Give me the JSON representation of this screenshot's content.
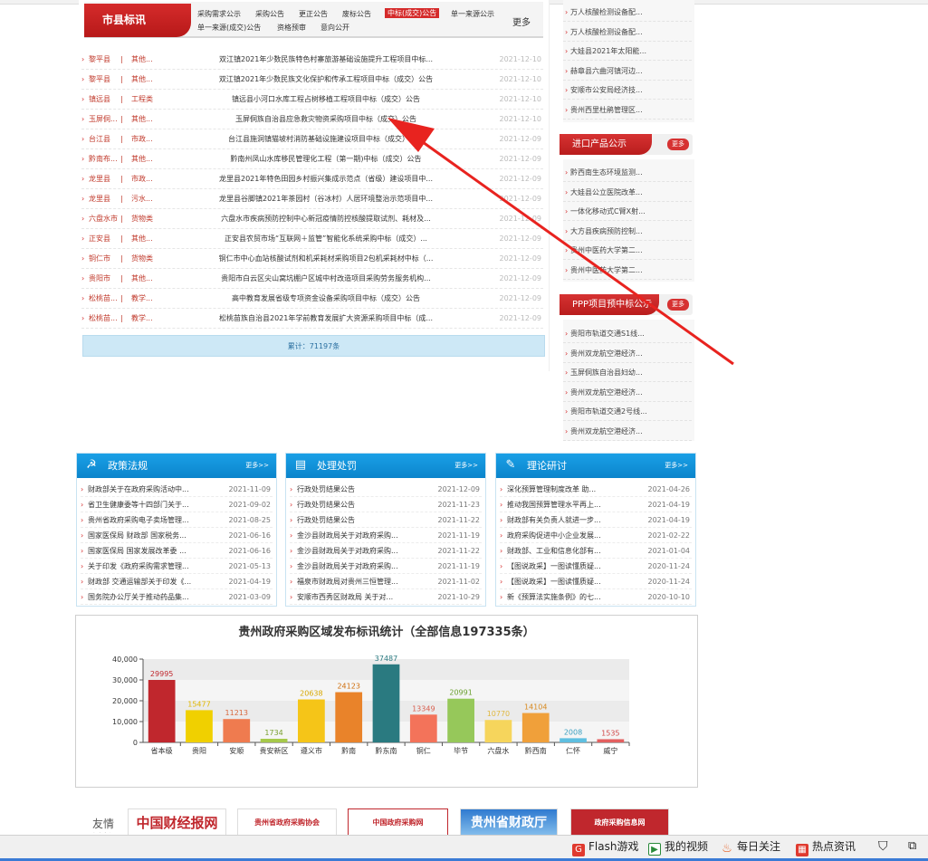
{
  "main": {
    "tab_label": "市县标讯",
    "more_label": "更多",
    "categories": [
      "采购需求公示",
      "采购公告",
      "更正公告",
      "废标公告",
      "中标(成交)公告",
      "单一来源公示",
      "单一来源(成交)公告",
      "资格预审",
      "意向公开"
    ],
    "rows": [
      {
        "region": "黎平县",
        "type": "其他...",
        "title": "双江镇2021年少数民族特色村寨旅游基础设施提升工程项目中标...",
        "date": "2021-12-10"
      },
      {
        "region": "黎平县",
        "type": "其他...",
        "title": "双江镇2021年少数民族文化保护和传承工程项目中标（成交）公告",
        "date": "2021-12-10"
      },
      {
        "region": "镇远县",
        "type": "工程类",
        "title": "镇远县小河口水库工程占树移植工程项目中标（成交）公告",
        "date": "2021-12-10"
      },
      {
        "region": "玉屏侗...",
        "type": "其他...",
        "title": "玉屏侗族自治县应急救灾物资采购项目中标（成交）公告",
        "date": "2021-12-10"
      },
      {
        "region": "台江县",
        "type": "市政...",
        "title": "台江县施洞镇猫坡村消防基础设施建设项目中标（成交）公告",
        "date": "2021-12-09"
      },
      {
        "region": "黔南布...",
        "type": "其他...",
        "title": "黔南州凤山水库移民管理化工程（第一期)中标（成交）公告",
        "date": "2021-12-09"
      },
      {
        "region": "龙里县",
        "type": "市政...",
        "title": "龙里县2021年特色田园乡村振兴集成示范点（省级）建设项目中...",
        "date": "2021-12-09"
      },
      {
        "region": "龙里县",
        "type": "污水...",
        "title": "龙里县谷脚镇2021年茶园村（谷冰村）人居环境整治示范项目中...",
        "date": "2021-12-09"
      },
      {
        "region": "六盘水市",
        "type": "货物类",
        "title": "六盘水市疾病预防控制中心新冠疫情防控核酸提取试剂、耗材及...",
        "date": "2021-12-09"
      },
      {
        "region": "正安县",
        "type": "其他...",
        "title": "正安县农贸市场“互联网＋监管”智能化系统采购中标（成交）...",
        "date": "2021-12-09"
      },
      {
        "region": "铜仁市",
        "type": "货物类",
        "title": "铜仁市中心血站核酸试剂和机采耗材采购项目2包机采耗材中标（...",
        "date": "2021-12-09"
      },
      {
        "region": "贵阳市",
        "type": "其他...",
        "title": "贵阳市白云区尖山窝坑棚户区城中村改造项目采购劳务服务机构...",
        "date": "2021-12-09"
      },
      {
        "region": "松桃苗...",
        "type": "教学...",
        "title": "高中教育发展省级专项资金设备采购项目中标（成交）公告",
        "date": "2021-12-09"
      },
      {
        "region": "松桃苗...",
        "type": "教学...",
        "title": "松桃苗族自治县2021年学前教育发展扩大资源采购项目中标（成...",
        "date": "2021-12-09"
      }
    ],
    "total_text": "累计：71197条"
  },
  "side": {
    "top_items": [
      "万人核酸检测设备配...",
      "万人核酸检测设备配...",
      "大娃县2021年太阳能...",
      "赫章县六曲河镇河边...",
      "安顺市公安局经济技...",
      "贵州西里杜鹃管理区..."
    ],
    "import": {
      "label": "进口产品公示",
      "more": "更多",
      "items": [
        "黔西南生态环境监测...",
        "大娃县公立医院改革...",
        "一体化移动式C臂X射...",
        "大方县疾病预防控制...",
        "贵州中医药大学第二...",
        "贵州中医药大学第二..."
      ]
    },
    "ppp": {
      "label": "PPP项目预中标公示",
      "more": "更多",
      "items": [
        "贵阳市轨道交通S1线...",
        "贵州双龙航空港经济...",
        "玉屏侗族自治县妇幼...",
        "贵州双龙航空港经济...",
        "贵阳市轨道交通2号线...",
        "贵州双龙航空港经济..."
      ]
    }
  },
  "boxes": [
    {
      "title": "政策法规",
      "more": "更多>>",
      "items": [
        {
          "t": "财政部关于在政府采购活动中...",
          "d": "2021-11-09"
        },
        {
          "t": "省卫生健康委等十四部门关于...",
          "d": "2021-09-02"
        },
        {
          "t": "贵州省政府采购电子卖场管理...",
          "d": "2021-08-25"
        },
        {
          "t": "国家医保局 财政部 国家税务...",
          "d": "2021-06-16"
        },
        {
          "t": "国家医保局 国家发展改革委 ...",
          "d": "2021-06-16"
        },
        {
          "t": "关于印发《政府采购需求管理...",
          "d": "2021-05-13"
        },
        {
          "t": "财政部 交通运输部关于印发《...",
          "d": "2021-04-19"
        },
        {
          "t": "国务院办公厅关于推动药品集...",
          "d": "2021-03-09"
        }
      ]
    },
    {
      "title": "处理处罚",
      "more": "更多>>",
      "items": [
        {
          "t": "行政处罚结果公告",
          "d": "2021-12-09"
        },
        {
          "t": "行政处罚结果公告",
          "d": "2021-11-23"
        },
        {
          "t": "行政处罚结果公告",
          "d": "2021-11-22"
        },
        {
          "t": "金沙县财政局关于对政府采购...",
          "d": "2021-11-19"
        },
        {
          "t": "金沙县财政局关于对政府采购...",
          "d": "2021-11-22"
        },
        {
          "t": "金沙县财政局关于对政府采购...",
          "d": "2021-11-19"
        },
        {
          "t": "福泉市财政局对贵州三恒管理...",
          "d": "2021-11-02"
        },
        {
          "t": "安顺市西秀区财政局 关于对...",
          "d": "2021-10-29"
        }
      ]
    },
    {
      "title": "理论研讨",
      "more": "更多>>",
      "items": [
        {
          "t": "深化预算管理制度改革 助...",
          "d": "2021-04-26"
        },
        {
          "t": "推动我国预算管理水平再上...",
          "d": "2021-04-19"
        },
        {
          "t": "财政部有关负责人就进一步...",
          "d": "2021-04-19"
        },
        {
          "t": "政府采购促进中小企业发展...",
          "d": "2021-02-22"
        },
        {
          "t": "财政部、工业和信息化部有...",
          "d": "2021-01-04"
        },
        {
          "t": "【图说政采】一图读懂质疑...",
          "d": "2020-11-24"
        },
        {
          "t": "【图说政采】一图读懂质疑...",
          "d": "2020-11-24"
        },
        {
          "t": "新《预算法实施条例》的七...",
          "d": "2020-10-10"
        }
      ]
    }
  ],
  "chart_data": {
    "type": "bar",
    "title": "贵州政府采购区域发布标讯统计（全部信息197335条）",
    "categories": [
      "省本级",
      "贵阳",
      "安顺",
      "贵安新区",
      "遵义市",
      "黔南",
      "黔东南",
      "铜仁",
      "毕节",
      "六盘水",
      "黔西南",
      "仁怀",
      "威宁"
    ],
    "values": [
      29995,
      15477,
      11213,
      1734,
      20638,
      24123,
      37487,
      13349,
      20991,
      10770,
      14104,
      2008,
      1535
    ],
    "ylim": [
      0,
      40000
    ],
    "yticks": [
      "0",
      "10,000",
      "20,000",
      "30,000",
      "40,000"
    ],
    "colors": [
      "#c0272d",
      "#f0d000",
      "#ef7b4f",
      "#a6c94a",
      "#f5c518",
      "#e9832a",
      "#2a7a80",
      "#f3735a",
      "#96c85a",
      "#f6d55c",
      "#f0a03a",
      "#5fbfe0",
      "#e46060"
    ],
    "label_colors": [
      "#c0272d",
      "#e0b800",
      "#d86a40",
      "#7aa030",
      "#d8a800",
      "#d07010",
      "#2a7a80",
      "#d86050",
      "#6aa030",
      "#e0b840",
      "#d88a20",
      "#3a9fc0",
      "#d04848"
    ]
  },
  "friends": {
    "label": "友情链接",
    "logos": [
      "中国财经报网",
      "贵州省政府采购协会",
      "中国政府采购网 www.ccgp.gov.cn",
      "贵州省财政厅",
      "政府采购信息网 www.caigou2003.com"
    ]
  },
  "statusbar": {
    "items": [
      "Flash游戏",
      "我的视频",
      "每日关注",
      "热点资讯"
    ]
  }
}
